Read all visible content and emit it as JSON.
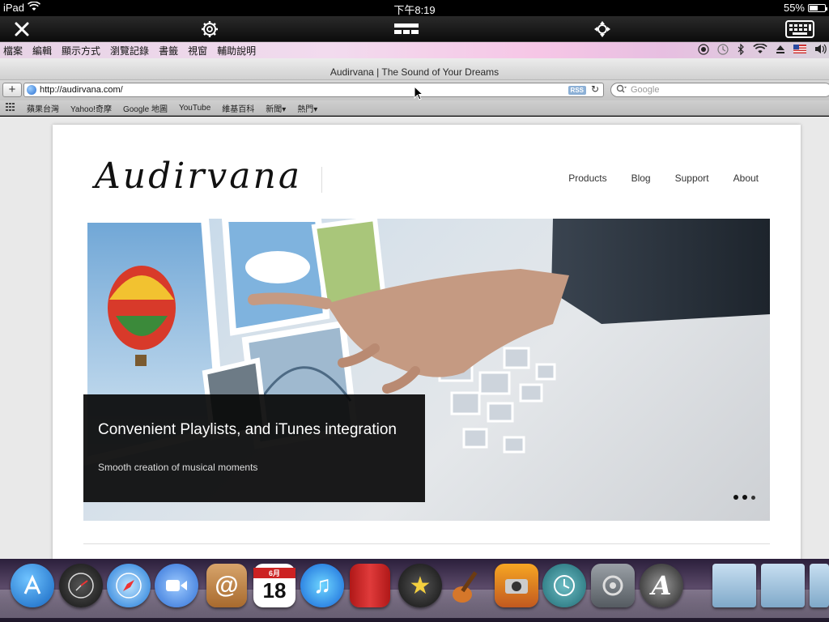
{
  "ios_status": {
    "device": "iPad",
    "time": "下午8:19",
    "battery": "55%",
    "battery_level": 0.55
  },
  "menubar": {
    "items": [
      "檔案",
      "編輯",
      "顯示方式",
      "瀏覽記錄",
      "書籤",
      "視窗",
      "輔助說明"
    ],
    "extras": [
      "record-icon",
      "time-machine-icon",
      "bluetooth-icon",
      "wifi-icon",
      "eject-icon",
      "flag-icon",
      "volume-icon"
    ]
  },
  "browser": {
    "window_title": "Audirvana | The Sound of Your Dreams",
    "url": "http://audirvana.com/",
    "rss_label": "RSS",
    "search_placeholder": "Google",
    "bookmarks": [
      "蘋果台灣",
      "Yahoo!奇摩",
      "Google 地圖",
      "YouTube",
      "維基百科",
      "新聞▾",
      "熱門▾"
    ]
  },
  "site": {
    "logo_text": "Audirvana",
    "nav": [
      "Products",
      "Blog",
      "Support",
      "About"
    ],
    "hero": {
      "title": "Convenient Playlists, and iTunes integration",
      "subtitle": "Smooth creation of musical moments",
      "slides": 3,
      "active_slide": 1
    }
  },
  "dock": {
    "apps": [
      "app-store-icon",
      "dashboard-icon",
      "safari-icon",
      "facetime-icon",
      "address-book-icon",
      "calendar-icon",
      "itunes-icon",
      "photo-booth-icon",
      "imovie-icon",
      "garageband-icon",
      "iphoto-icon",
      "time-machine-icon",
      "system-preferences-icon",
      "audirvana-icon",
      "applications-folder-icon",
      "documents-folder-icon",
      "downloads-folder-icon"
    ],
    "calendar_day": "18",
    "calendar_month": "6月"
  }
}
